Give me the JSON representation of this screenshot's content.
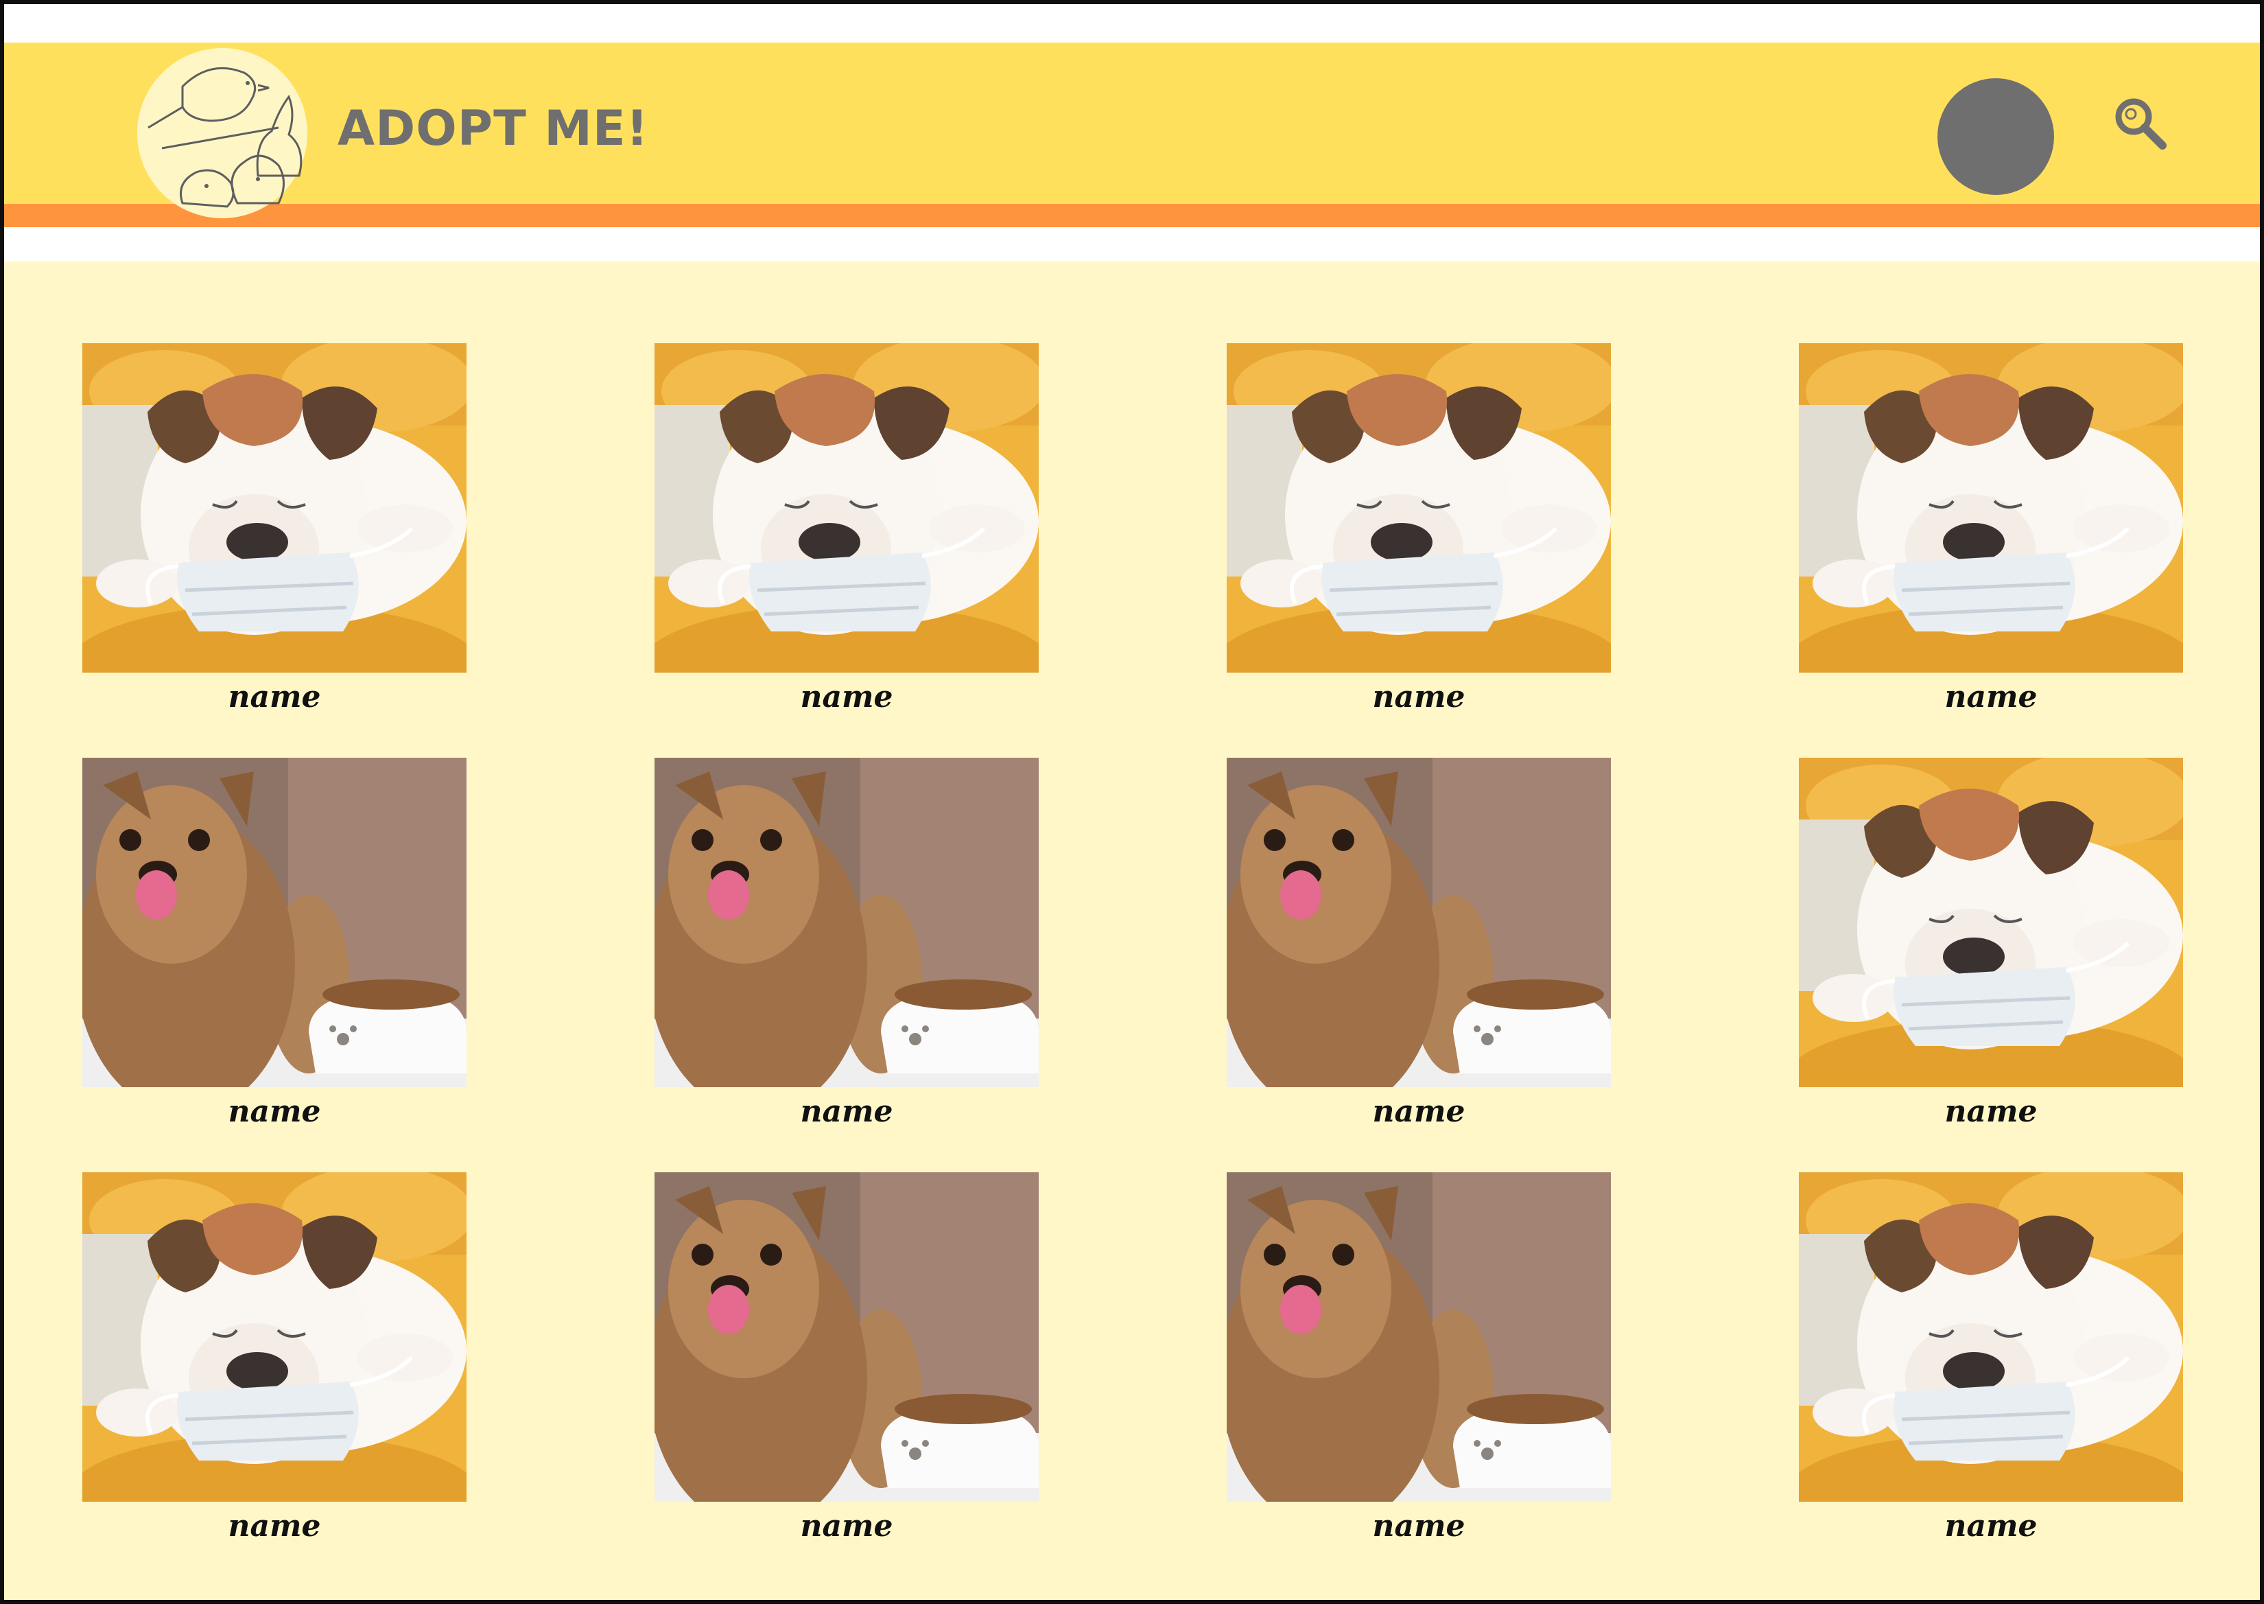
{
  "header": {
    "title": "ADOPT ME!",
    "logo_icon": "pets-logo-icon",
    "avatar_icon": "user-avatar",
    "search_icon": "search-icon"
  },
  "colors": {
    "header": "#ffe05d",
    "accent_stripe": "#ff943e",
    "page_background": "#fff7c8",
    "text_gray": "#6f6f6f"
  },
  "pets": [
    {
      "name": "name",
      "photo": "bulldog-photo"
    },
    {
      "name": "name",
      "photo": "bulldog-photo"
    },
    {
      "name": "name",
      "photo": "bulldog-photo"
    },
    {
      "name": "name",
      "photo": "bulldog-photo"
    },
    {
      "name": "name",
      "photo": "yorkie-photo"
    },
    {
      "name": "name",
      "photo": "yorkie-photo"
    },
    {
      "name": "name",
      "photo": "yorkie-photo"
    },
    {
      "name": "name",
      "photo": "bulldog-photo"
    },
    {
      "name": "name",
      "photo": "bulldog-photo"
    },
    {
      "name": "name",
      "photo": "yorkie-photo"
    },
    {
      "name": "name",
      "photo": "yorkie-photo"
    },
    {
      "name": "name",
      "photo": "bulldog-photo"
    }
  ]
}
